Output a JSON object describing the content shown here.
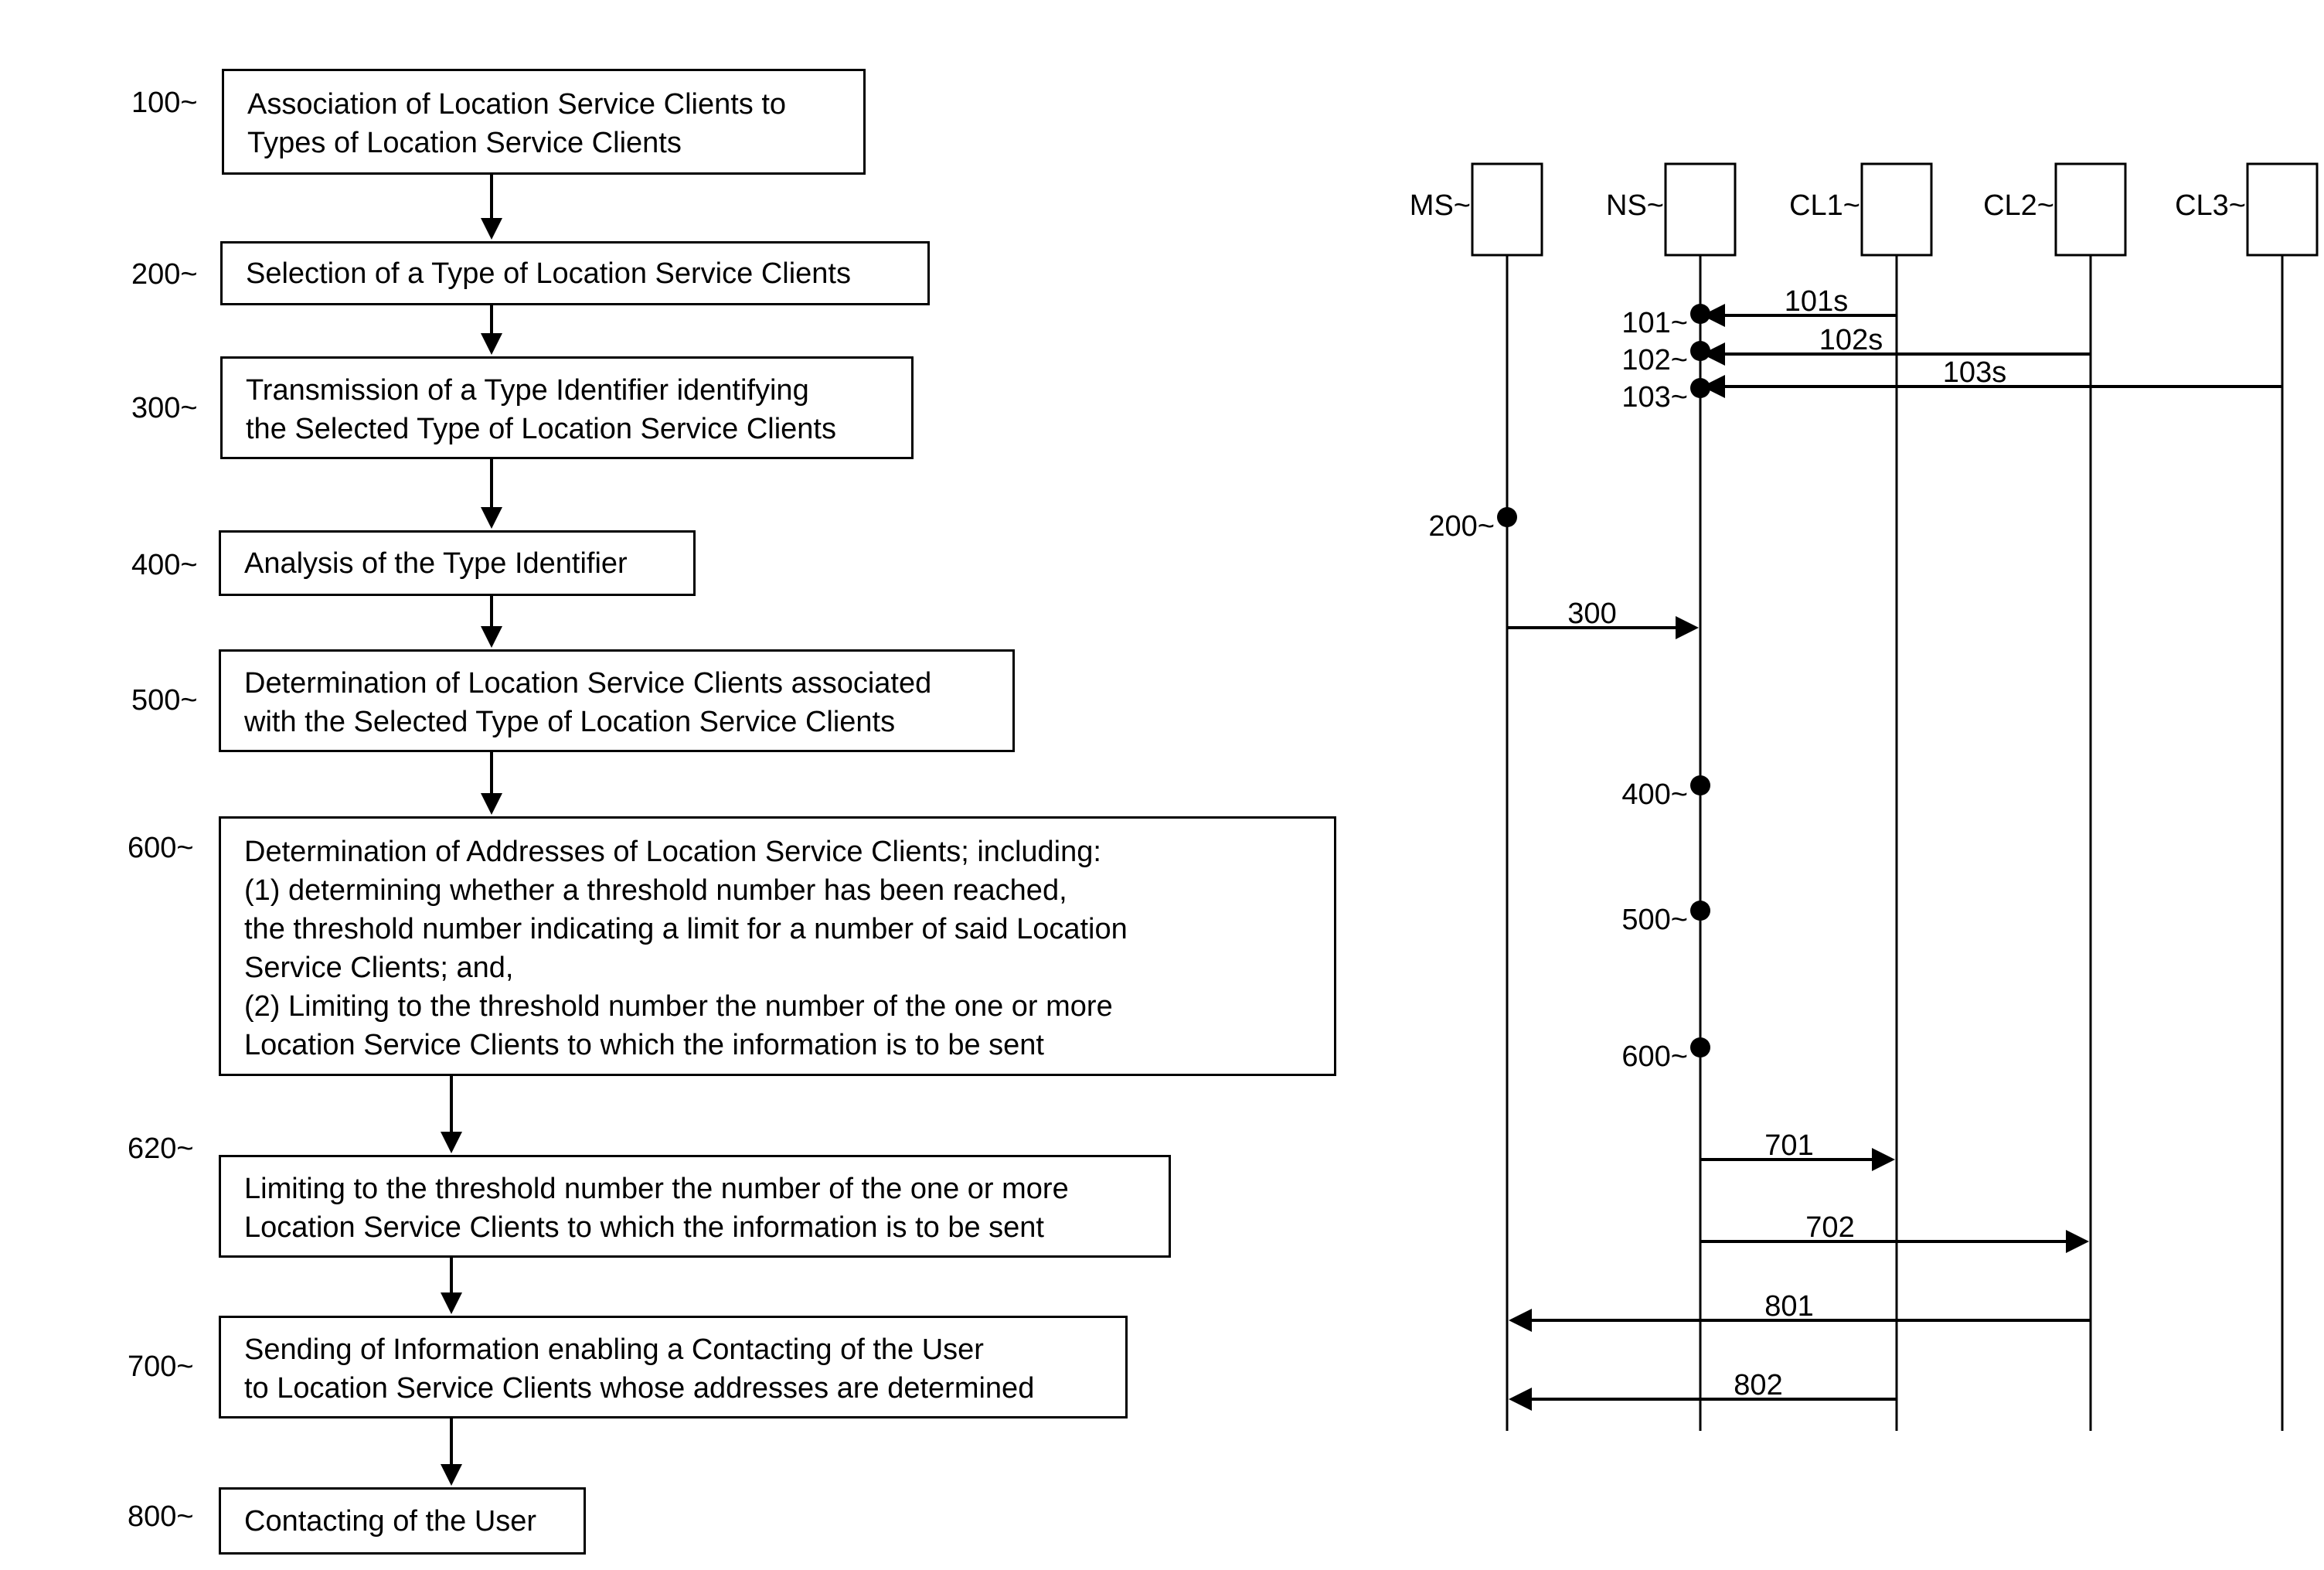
{
  "flowchart": {
    "steps": [
      {
        "id": "100",
        "label": "100~",
        "text": "Association of Location Service Clients to\nTypes of Location Service Clients"
      },
      {
        "id": "200",
        "label": "200~",
        "text": "Selection of a Type of Location Service Clients"
      },
      {
        "id": "300",
        "label": "300~",
        "text": "Transmission of a Type Identifier identifying\nthe Selected Type of Location Service Clients"
      },
      {
        "id": "400",
        "label": "400~",
        "text": "Analysis of the Type Identifier"
      },
      {
        "id": "500",
        "label": "500~",
        "text": "Determination of Location Service Clients associated\nwith the Selected Type of Location Service Clients"
      },
      {
        "id": "600",
        "label": "600~",
        "text": "Determination of Addresses of Location Service Clients; including:\n(1) determining whether a threshold number has been reached,\nthe threshold number indicating a limit for a number of said Location\nService Clients; and,\n(2) Limiting to the threshold number the number of the one or more\nLocation Service Clients to which the information is to be sent"
      },
      {
        "id": "620",
        "label": "620~",
        "text": "Limiting to the threshold number the number of the one or more\nLocation Service Clients to which the information is to be sent"
      },
      {
        "id": "700",
        "label": "700~",
        "text": "Sending of Information enabling a Contacting of the User\nto Location Service Clients whose addresses are determined"
      },
      {
        "id": "800",
        "label": "800~",
        "text": "Contacting of the User"
      }
    ]
  },
  "sequence": {
    "participants": [
      {
        "id": "MS",
        "label": "MS~"
      },
      {
        "id": "NS",
        "label": "NS~"
      },
      {
        "id": "CL1",
        "label": "CL1~"
      },
      {
        "id": "CL2",
        "label": "CL2~"
      },
      {
        "id": "CL3",
        "label": "CL3~"
      }
    ],
    "events": [
      {
        "label": "101~",
        "on": "NS"
      },
      {
        "label": "102~",
        "on": "NS"
      },
      {
        "label": "103~",
        "on": "NS"
      },
      {
        "label": "200~",
        "on": "MS"
      },
      {
        "label": "400~",
        "on": "NS"
      },
      {
        "label": "500~",
        "on": "NS"
      },
      {
        "label": "600~",
        "on": "NS"
      }
    ],
    "messages": [
      {
        "label": "101s",
        "from": "CL1",
        "to": "NS"
      },
      {
        "label": "102s",
        "from": "CL2",
        "to": "NS"
      },
      {
        "label": "103s",
        "from": "CL3",
        "to": "NS"
      },
      {
        "label": "300",
        "from": "MS",
        "to": "NS"
      },
      {
        "label": "701",
        "from": "NS",
        "to": "CL1"
      },
      {
        "label": "702",
        "from": "NS",
        "to": "CL2"
      },
      {
        "label": "801",
        "from": "CL2",
        "to": "MS"
      },
      {
        "label": "802",
        "from": "CL1",
        "to": "MS"
      }
    ]
  }
}
